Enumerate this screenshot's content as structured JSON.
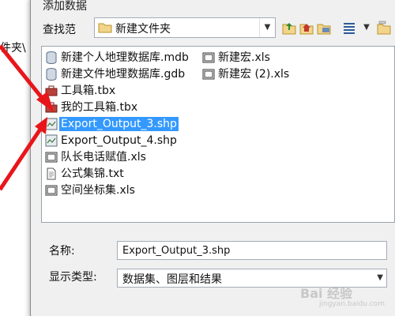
{
  "background_window": {
    "partial_text": "件夹\\"
  },
  "dialog": {
    "title": "添加数据",
    "look_in": {
      "label": "查找范",
      "value": "新建文件夹"
    },
    "toolbar": {
      "icons": [
        "up-folder-icon",
        "home-icon",
        "connect-folder-icon",
        "view-list-icon",
        "dropdown-arrow-icon",
        "new-folder-icon"
      ]
    },
    "files": [
      {
        "name": "新建个人地理数据库.mdb",
        "icon": "database-icon",
        "selected": false
      },
      {
        "name": "新建文件地理数据库.gdb",
        "icon": "database-icon",
        "selected": false
      },
      {
        "name": "工具箱.tbx",
        "icon": "toolbox-icon",
        "selected": false
      },
      {
        "name": "我的工具箱.tbx",
        "icon": "toolbox-icon",
        "selected": false
      },
      {
        "name": "Export_Output_3.shp",
        "icon": "shapefile-icon",
        "selected": true
      },
      {
        "name": "Export_Output_4.shp",
        "icon": "shapefile-icon",
        "selected": false
      },
      {
        "name": "队长电话赋值.xls",
        "icon": "table-icon",
        "selected": false
      },
      {
        "name": "公式集锦.txt",
        "icon": "text-file-icon",
        "selected": false
      },
      {
        "name": "空间坐标集.xls",
        "icon": "table-icon",
        "selected": false
      },
      {
        "name": "新建宏.xls",
        "icon": "table-icon",
        "selected": false
      },
      {
        "name": "新建宏 (2).xls",
        "icon": "table-icon",
        "selected": false
      }
    ],
    "name_field": {
      "label": "名称:",
      "value": "Export_Output_3.shp"
    },
    "type_select": {
      "label": "显示类型:",
      "value": "数据集、图层和结果"
    }
  },
  "watermark": {
    "text": "Bai 经验",
    "sub": "jingyan.baidu.com"
  },
  "colors": {
    "selection": "#3399ff",
    "annotation": "#e8161a",
    "dialog_bg": "#f0f0f0"
  }
}
